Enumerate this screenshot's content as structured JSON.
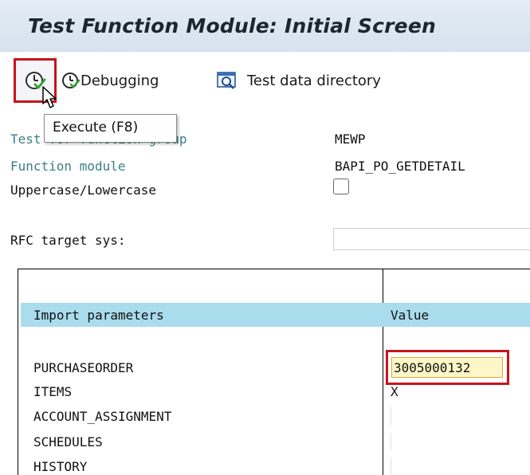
{
  "title": "Test Function Module: Initial Screen",
  "toolbar": {
    "execute": {
      "icon": "execute-icon"
    },
    "debugging": {
      "label": "Debugging",
      "icon": "debugging-icon"
    },
    "test_data_directory": {
      "label": "Test data directory",
      "icon": "test-data-directory-icon"
    }
  },
  "tooltip": {
    "text": "Execute  (F8)"
  },
  "fields": {
    "function_group": {
      "label": "Test for function group",
      "value": "MEWP"
    },
    "function_module": {
      "label": "Function module",
      "value": "BAPI_PO_GETDETAIL"
    },
    "case": {
      "label": "Uppercase/Lowercase",
      "checked": false
    },
    "rfc": {
      "label": "RFC target sys:",
      "value": ""
    }
  },
  "table": {
    "col_param": "Import parameters",
    "col_value": "Value",
    "rows": [
      {
        "name": "PURCHASEORDER",
        "value": "3005000132"
      },
      {
        "name": "ITEMS",
        "value": "X"
      },
      {
        "name": "ACCOUNT_ASSIGNMENT",
        "value": ""
      },
      {
        "name": "SCHEDULES",
        "value": ""
      },
      {
        "name": "HISTORY",
        "value": ""
      }
    ]
  },
  "colors": {
    "title_bg": "#dde6f0",
    "highlight_red": "#c9141c",
    "label_blue": "#3b7f85",
    "table_header_bg": "#a9dcec",
    "input_yellow": "#fdf6c6"
  }
}
